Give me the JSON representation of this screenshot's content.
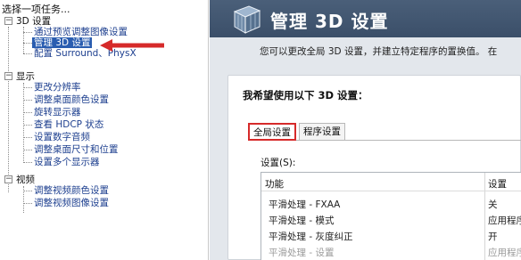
{
  "left_panel": {
    "title": "选择一项任务...",
    "categories": [
      {
        "label": "3D 设置",
        "items": [
          "通过预览调整图像设置",
          "管理 3D 设置",
          "配置 Surround、PhysX"
        ]
      },
      {
        "label": "显示",
        "items": [
          "更改分辨率",
          "调整桌面颜色设置",
          "旋转显示器",
          "查看 HDCP 状态",
          "设置数字音频",
          "调整桌面尺寸和位置",
          "设置多个显示器"
        ]
      },
      {
        "label": "视频",
        "items": [
          "调整视频颜色设置",
          "调整视频图像设置"
        ]
      }
    ],
    "selected_item": "管理 3D 设置",
    "arrow_color": "#d62a2a"
  },
  "right_panel": {
    "title": "管理 3D 设置",
    "description": "您可以更改全局 3D 设置，并建立特定程序的置换值。 在",
    "section_title": "我希望使用以下 3D 设置：",
    "tabs": [
      "全局设置",
      "程序设置"
    ],
    "active_tab": "全局设置",
    "settings_label": "设置(S):",
    "table": {
      "columns": [
        "功能",
        "设置"
      ],
      "rows": [
        {
          "feature": "平滑处理 - FXAA",
          "value": "关"
        },
        {
          "feature": "平滑处理 - 模式",
          "value": "应用程序"
        },
        {
          "feature": "平滑处理 - 灰度纠正",
          "value": "开"
        },
        {
          "feature": "平滑处理 - 设置",
          "value": "应用程序"
        }
      ]
    }
  },
  "colors": {
    "banner": "#42566f",
    "selection": "#2a5db0",
    "link": "#1d3f8f",
    "highlight_border": "#d62a2a"
  }
}
